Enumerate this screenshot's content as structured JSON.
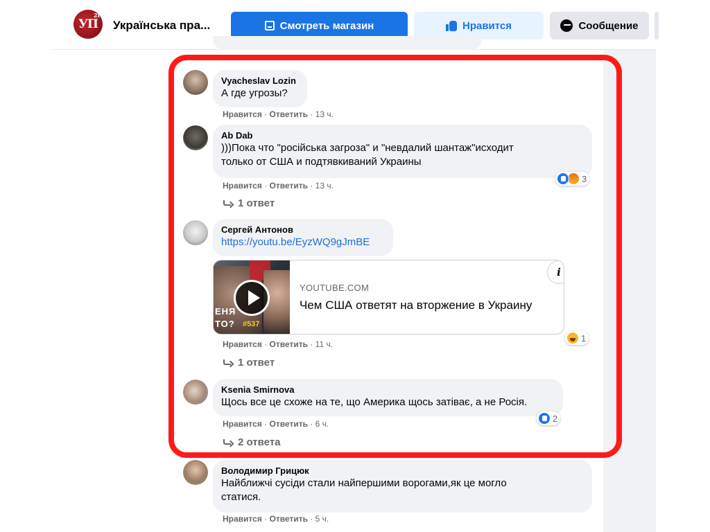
{
  "header": {
    "page_name": "Українська пра...",
    "logo_text": "УП",
    "logo_badge": "21",
    "shop_button": "Смотреть магазин",
    "like_button": "Нравится",
    "message_button": "Сообщение"
  },
  "labels": {
    "like": "Нравится",
    "reply": "Ответить",
    "separator": "·"
  },
  "comments": [
    {
      "author": "Vyacheslav Lozin",
      "text": "А где угрозы?",
      "time": "13 ч."
    },
    {
      "author": "Ab Dab",
      "text_line1": ")))Пока что \"російська загроза\" и \"невдалий шантаж\"исходит",
      "text_line2": "только от США и подтявкиваний Украины",
      "time": "13 ч.",
      "reaction_count": "3",
      "reactions": [
        "like-icon",
        "angry-icon"
      ],
      "replies": "1 ответ"
    },
    {
      "author": "Сергей Антонов",
      "link": "https://youtu.be/EyzWQ9gJmBE",
      "preview": {
        "domain": "YOUTUBE.COM",
        "title": "Чем США ответят на вторжение в Украину",
        "thumb_caption1": "ЕНЯ",
        "thumb_caption2": "ТО?",
        "thumb_number": "#537",
        "info_label": "i"
      },
      "time": "11 ч.",
      "reaction_count": "1",
      "reactions": [
        "haha-icon"
      ],
      "replies": "1 ответ"
    },
    {
      "author": "Ksenia Smirnova",
      "text": "Щось все це схоже на те, що Америка щось затіває, а не Росія.",
      "time": "6 ч.",
      "reaction_count": "2",
      "reactions": [
        "like-icon"
      ],
      "replies": "2 ответа"
    },
    {
      "author": "Володимир Грицюк",
      "text_line1": "Найближчі сусіди стали найпершими ворогами,як це могло",
      "text_line2": "статися.",
      "time": "5 ч."
    }
  ],
  "colors": {
    "accent": "#1b74e4",
    "highlight_frame": "#ff1a1a",
    "bubble": "#f0f2f5",
    "muted_text": "#65676b",
    "link": "#216fdb"
  }
}
